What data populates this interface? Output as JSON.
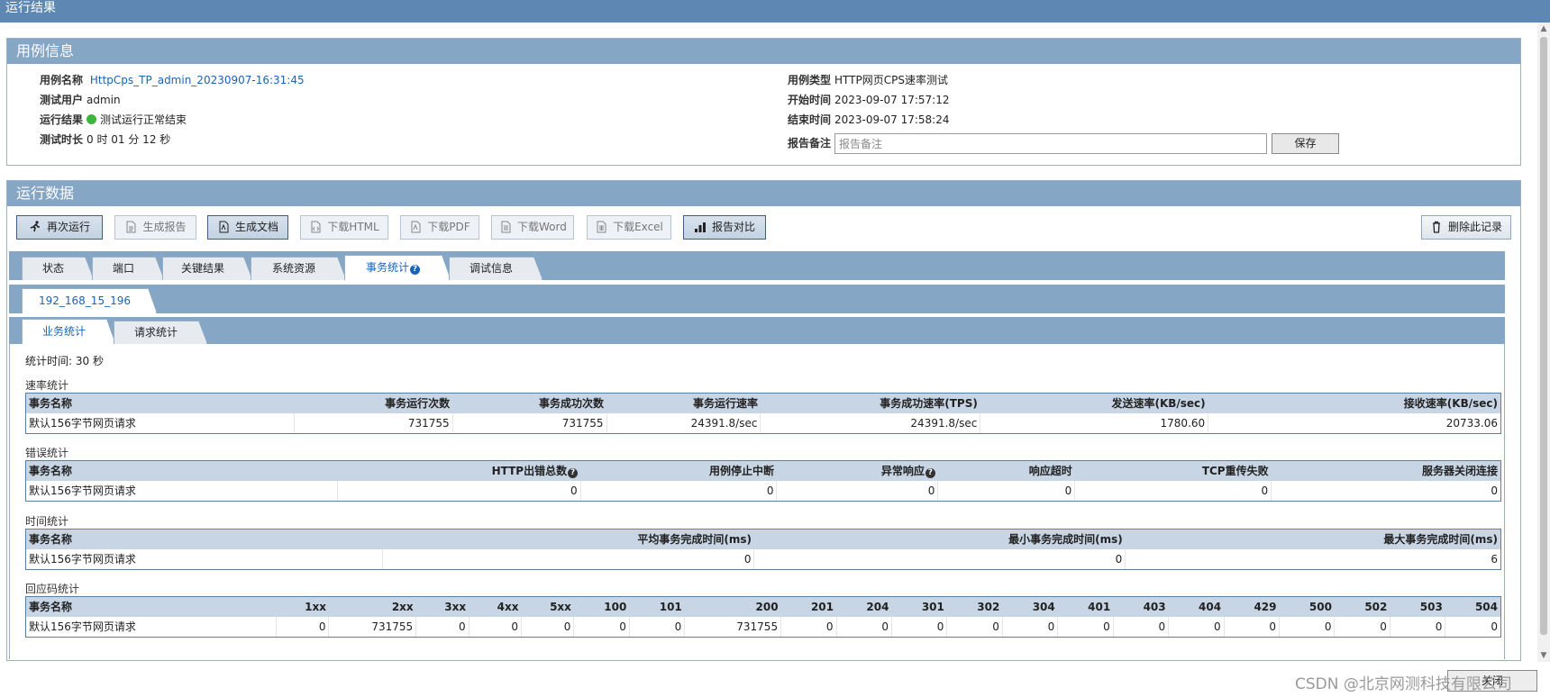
{
  "window": {
    "title": "运行结果"
  },
  "case_info": {
    "title": "用例信息",
    "name_label": "用例名称",
    "name_value": "HttpCps_TP_admin_20230907-16:31:45",
    "user_label": "测试用户",
    "user_value": "admin",
    "result_label": "运行结果",
    "result_value": "测试运行正常结束",
    "duration_label": "测试时长",
    "duration_value": "0 时 01 分 12 秒",
    "type_label": "用例类型",
    "type_value": "HTTP网页CPS速率测试",
    "start_label": "开始时间",
    "start_value": "2023-09-07 17:57:12",
    "end_label": "结束时间",
    "end_value": "2023-09-07 17:58:24",
    "note_label": "报告备注",
    "note_placeholder": "报告备注",
    "save_label": "保存",
    "status_color": "#3db43d"
  },
  "run_data": {
    "title": "运行数据",
    "toolbar": {
      "rerun": "再次运行",
      "gen_report": "生成报告",
      "gen_doc": "生成文档",
      "dl_html": "下载HTML",
      "dl_pdf": "下载PDF",
      "dl_word": "下载Word",
      "dl_excel": "下载Excel",
      "compare": "报告对比",
      "delete": "删除此记录"
    },
    "tabs": [
      "状态",
      "端口",
      "关键结果",
      "系统资源",
      "事务统计",
      "调试信息"
    ],
    "host_tab": "192_168_15_196",
    "sub_tabs": [
      "业务统计",
      "请求统计"
    ],
    "stat_time": "统计时间:  30 秒"
  },
  "rate_stats": {
    "title": "速率统计",
    "headers": [
      "事务名称",
      "事务运行次数",
      "事务成功次数",
      "事务运行速率",
      "事务成功速率(TPS)",
      "发送速率(KB/sec)",
      "接收速率(KB/sec)"
    ],
    "row": [
      "默认156字节网页请求",
      "731755",
      "731755",
      "24391.8/sec",
      "24391.8/sec",
      "1780.60",
      "20733.06"
    ]
  },
  "error_stats": {
    "title": "错误统计",
    "headers": [
      "事务名称",
      "HTTP出错总数",
      "用例停止中断",
      "异常响应",
      "响应超时",
      "TCP重传失败",
      "服务器关闭连接"
    ],
    "row": [
      "默认156字节网页请求",
      "0",
      "0",
      "0",
      "0",
      "0",
      "0"
    ]
  },
  "time_stats": {
    "title": "时间统计",
    "headers": [
      "事务名称",
      "平均事务完成时间(ms)",
      "最小事务完成时间(ms)",
      "最大事务完成时间(ms)"
    ],
    "row": [
      "默认156字节网页请求",
      "0",
      "0",
      "6"
    ]
  },
  "code_stats": {
    "title": "回应码统计",
    "headers": [
      "事务名称",
      "1xx",
      "2xx",
      "3xx",
      "4xx",
      "5xx",
      "100",
      "101",
      "200",
      "201",
      "204",
      "301",
      "302",
      "304",
      "401",
      "403",
      "404",
      "429",
      "500",
      "502",
      "503",
      "504"
    ],
    "row": [
      "默认156字节网页请求",
      "0",
      "731755",
      "0",
      "0",
      "0",
      "0",
      "0",
      "731755",
      "0",
      "0",
      "0",
      "0",
      "0",
      "0",
      "0",
      "0",
      "0",
      "0",
      "0",
      "0",
      "0"
    ]
  },
  "footer": {
    "watermark": "CSDN @北京网测科技有限公司",
    "close_label": "关闭"
  }
}
